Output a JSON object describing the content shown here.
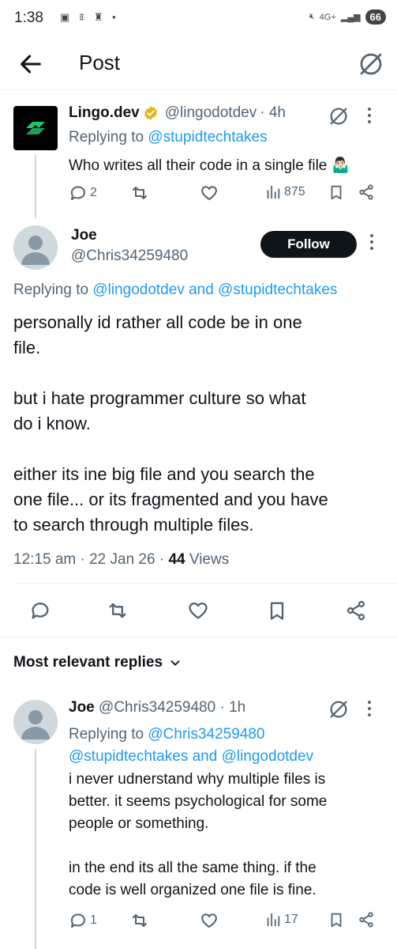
{
  "status_bar": {
    "time": "1:38",
    "network": "4G+",
    "battery": "66"
  },
  "header": {
    "title": "Post"
  },
  "tweet1": {
    "name": "Lingo.dev",
    "handle": "@lingodotdev",
    "time": "· 4h",
    "replying_prefix": "Replying to",
    "replying_to": "@stupidtechtakes",
    "text": "Who writes all their code in a single file 🤷🏻‍♂️",
    "replies": "2",
    "views": "875"
  },
  "tweet2": {
    "name": "Joe",
    "handle": "@Chris34259480",
    "follow_label": "Follow",
    "replying_prefix": "Replying to",
    "replying_to_1": "@lingodotdev",
    "replying_and": "and",
    "replying_to_2": "@stupidtechtakes",
    "body": [
      "personally id rather all code be in one",
      "file.",
      "",
      "but i hate programmer culture so what",
      "do i know.",
      "",
      "either its ine big file and you search the",
      "one file... or its fragmented and you have",
      "to search through multiple files."
    ],
    "meta_time": "12:15 am · 22 Jan 26 ·",
    "views_count": "44",
    "views_label": "Views"
  },
  "section": {
    "most_relevant": "Most relevant replies"
  },
  "tweet3": {
    "name": "Joe",
    "handle": "@Chris34259480",
    "time": "· 1h",
    "replying_prefix": "Replying to",
    "replying_to_1": "@Chris34259480",
    "replying_to_2": "@stupidtechtakes",
    "replying_and": "and",
    "replying_to_3": "@lingodotdev",
    "body": [
      "i never udnerstand why multiple files is",
      "better. it seems psychological for some",
      "people or something.",
      "",
      "in the end its all the same thing. if the",
      "code is well organized one file is fine."
    ],
    "replies": "1",
    "views": "17"
  },
  "colors": {
    "link": "#1d9bf0",
    "secondary": "#536471",
    "verified": "#e2b719",
    "brand_green": "#1fc86e"
  }
}
